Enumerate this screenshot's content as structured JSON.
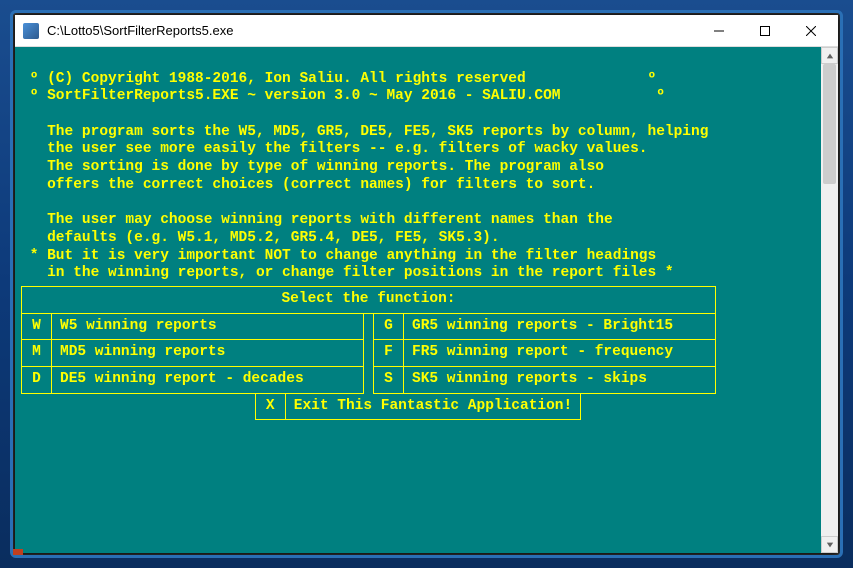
{
  "window": {
    "title": "C:\\Lotto5\\SortFilterReports5.exe"
  },
  "header": {
    "copyright": " º (C) Copyright 1988-2016, Ion Saliu. All rights reserved              º",
    "version": " º SortFilterReports5.EXE ~ version 3.0 ~ May 2016 - SALIU.COM           º"
  },
  "body": {
    "l1": "   The program sorts the W5, MD5, GR5, DE5, FE5, SK5 reports by column, helping",
    "l2": "   the user see more easily the filters -- e.g. filters of wacky values.",
    "l3": "   The sorting is done by type of winning reports. The program also",
    "l4": "   offers the correct choices (correct names) for filters to sort.",
    "l5": "   The user may choose winning reports with different names than the",
    "l6": "   defaults (e.g. W5.1, MD5.2, GR5.4, DE5, FE5, SK5.3).",
    "l7": " * But it is very important NOT to change anything in the filter headings",
    "l8": "   in the winning reports, or change filter positions in the report files *"
  },
  "menu": {
    "header": "Select the function:",
    "left": [
      {
        "key": "W",
        "label": "W5 winning reports"
      },
      {
        "key": "M",
        "label": "MD5 winning reports"
      },
      {
        "key": "D",
        "label": "DE5 winning report - decades"
      }
    ],
    "right": [
      {
        "key": "G",
        "label": "GR5 winning reports - Bright15"
      },
      {
        "key": "F",
        "label": "FR5 winning report - frequency"
      },
      {
        "key": "S",
        "label": "SK5 winning reports - skips"
      }
    ],
    "exit": {
      "key": "X",
      "label": "Exit This Fantastic Application!"
    }
  }
}
